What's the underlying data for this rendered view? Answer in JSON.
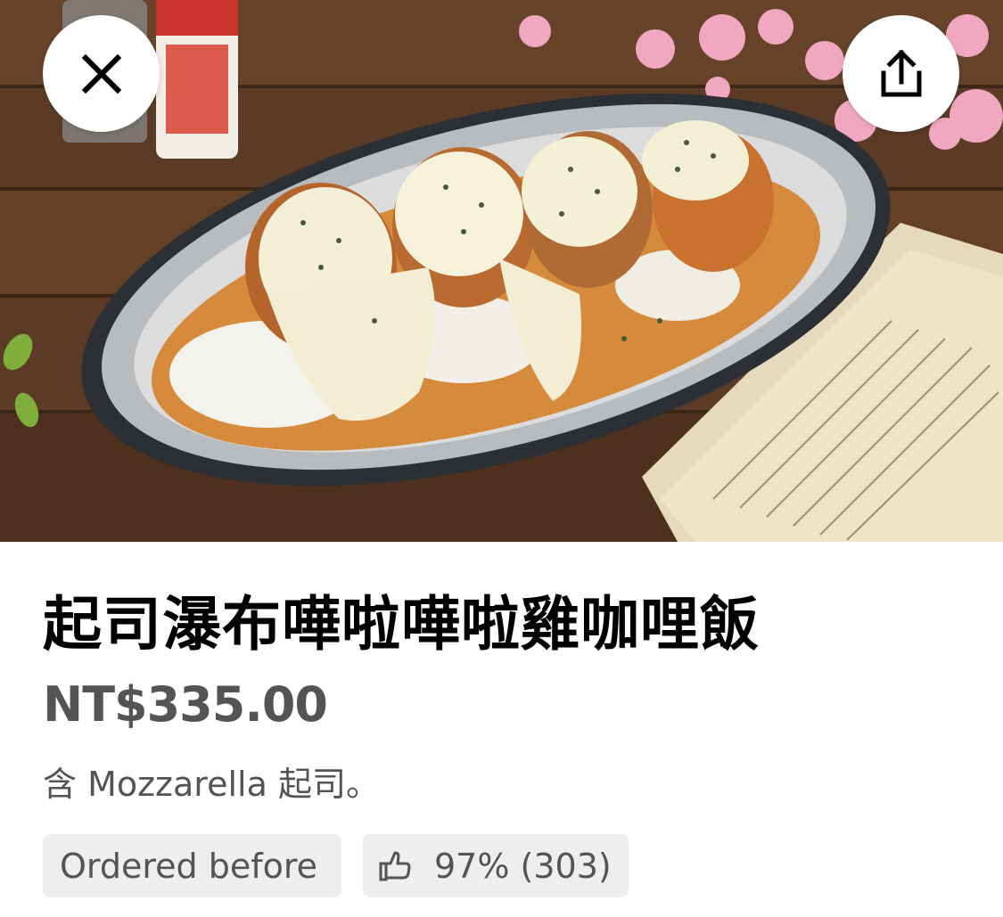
{
  "header": {
    "close_icon": "close-icon",
    "share_icon": "share-icon"
  },
  "item": {
    "title": "起司瀑布嘩啦嘩啦雞咖哩飯",
    "price": "NT$335.00",
    "description": "含 Mozzarella 起司。"
  },
  "badges": {
    "ordered_before": "Ordered before",
    "rating_icon": "thumbs-up-icon",
    "rating_text": "97% (303)"
  },
  "colors": {
    "text_primary": "#000000",
    "text_secondary": "#545454",
    "chip_background": "#eeeeee"
  }
}
